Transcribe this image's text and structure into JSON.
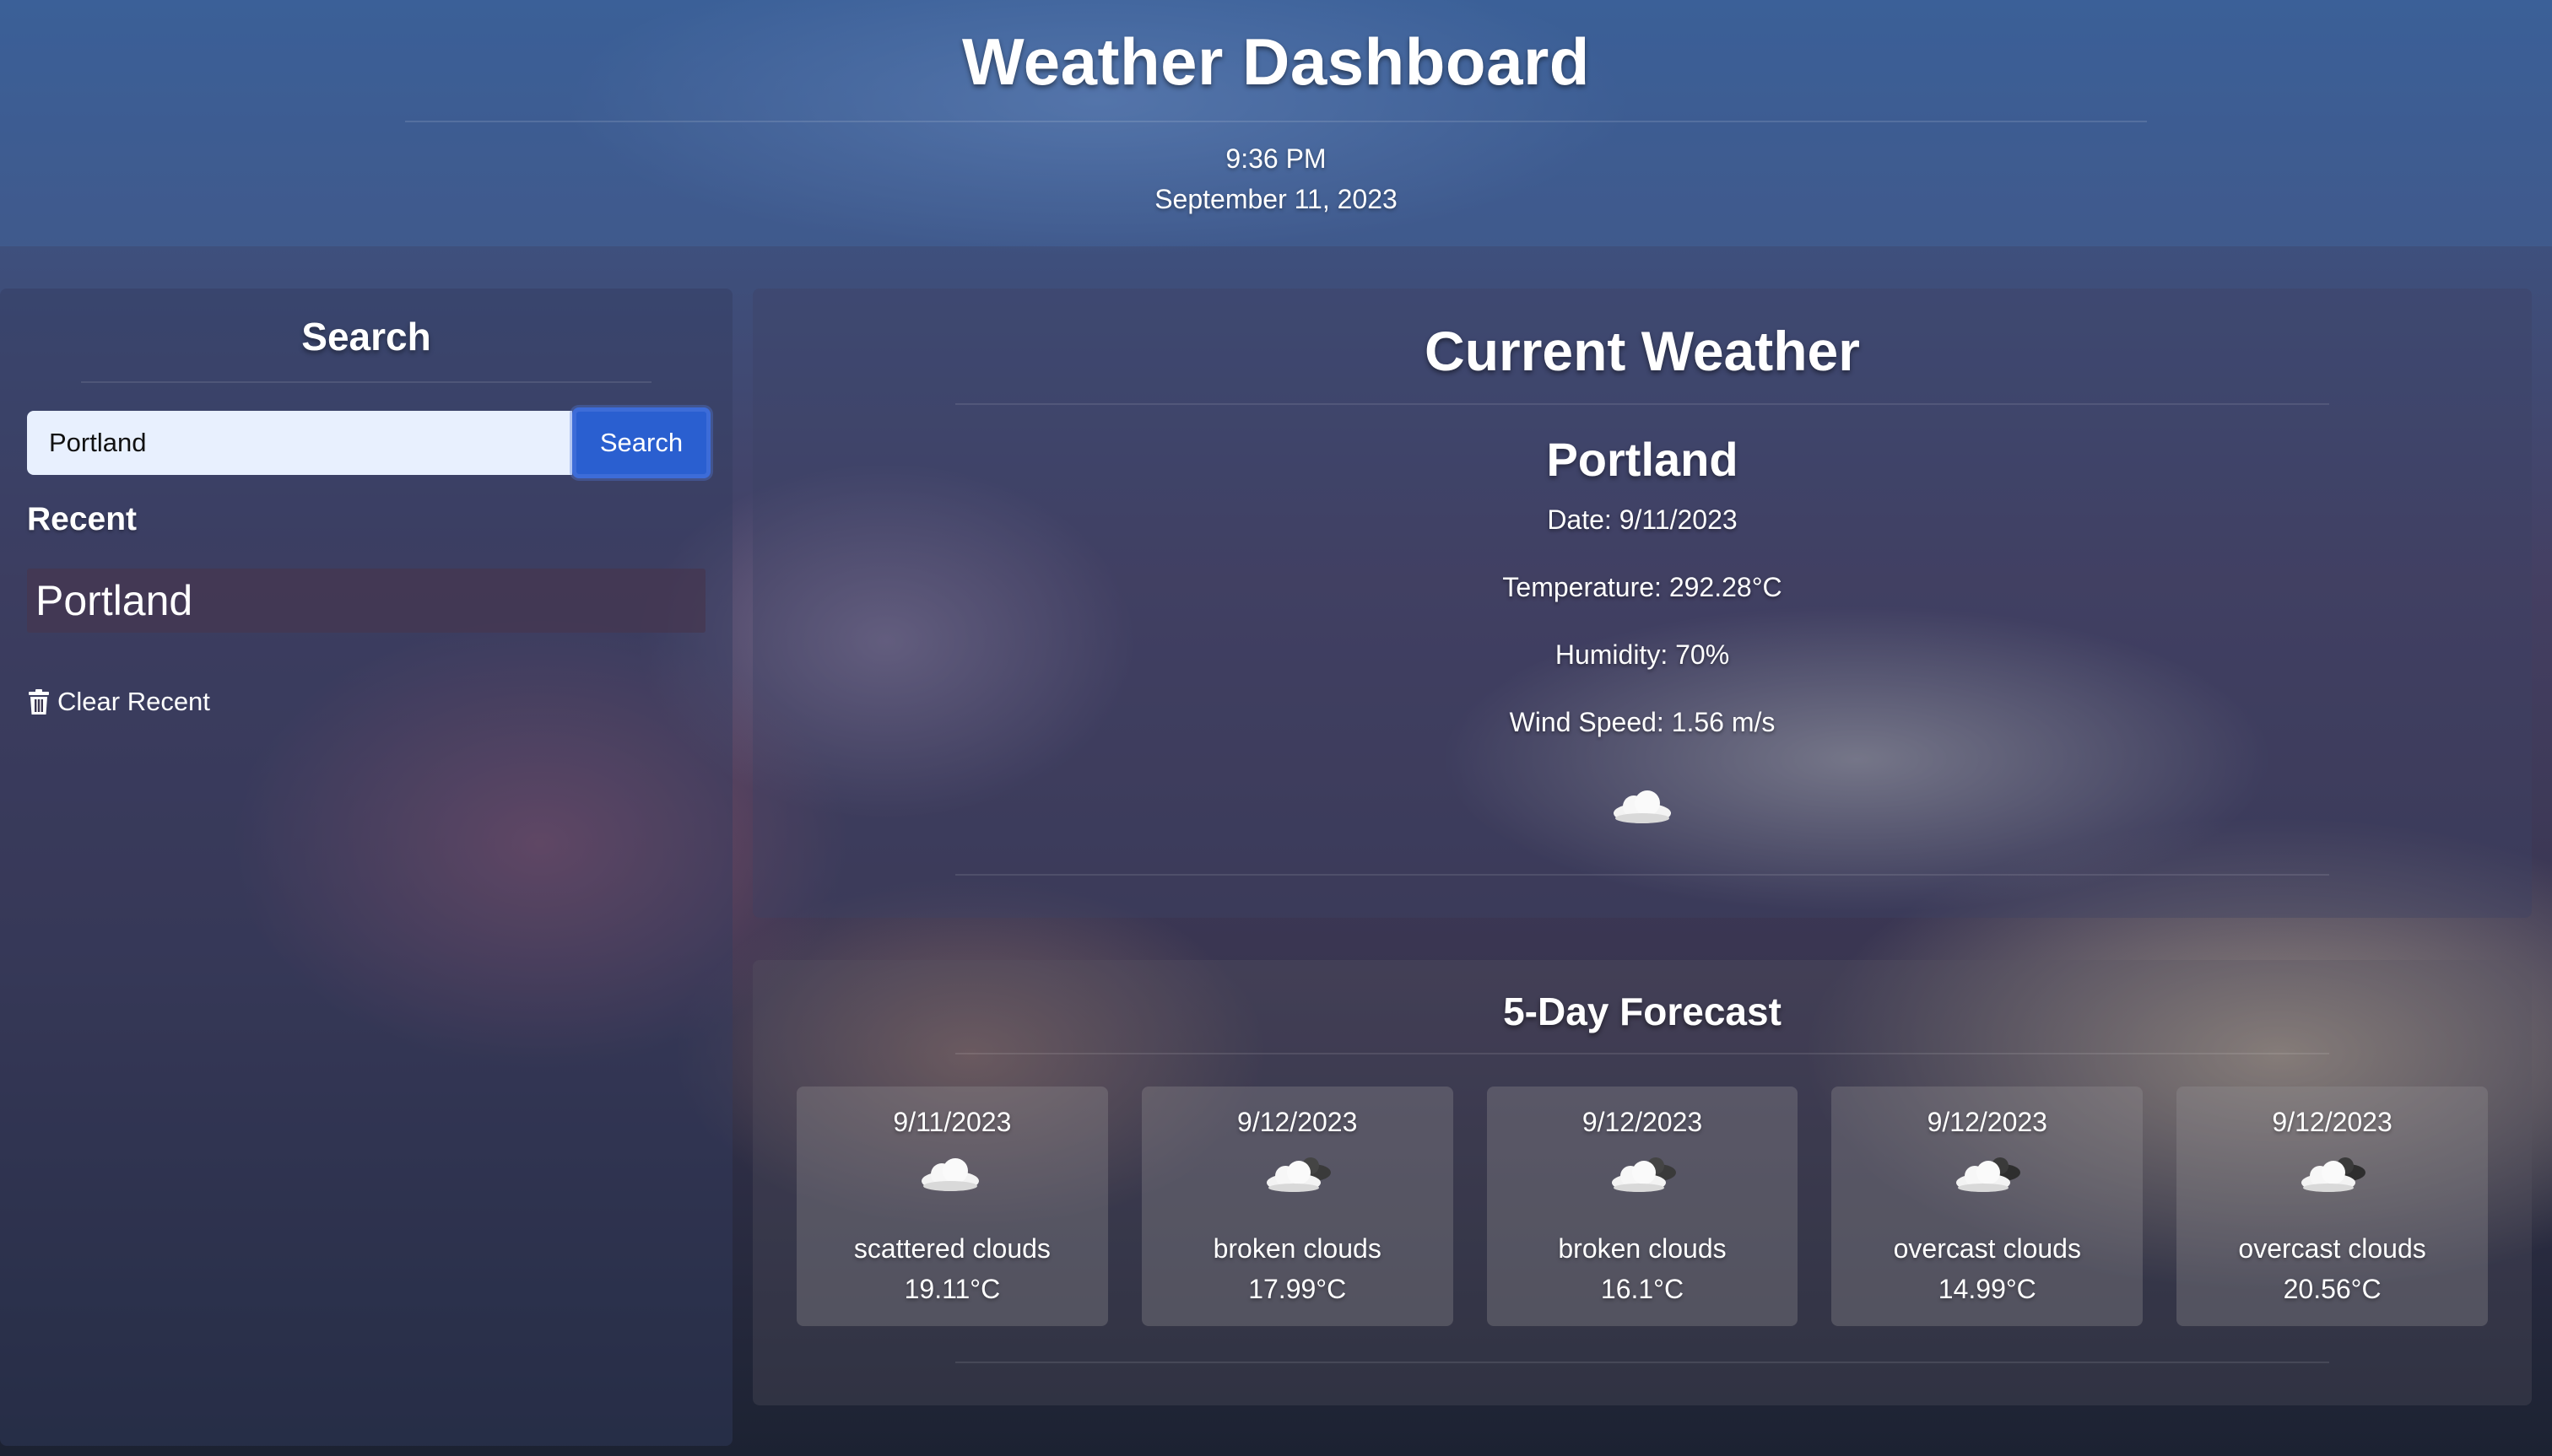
{
  "header": {
    "title": "Weather Dashboard",
    "time": "9:36 PM",
    "date": "September 11, 2023"
  },
  "sidebar": {
    "heading": "Search",
    "search": {
      "value": "Portland",
      "button_label": "Search"
    },
    "recent_label": "Recent",
    "recent_items": [
      "Portland"
    ],
    "clear_label": "Clear Recent",
    "clear_icon": "trash-icon"
  },
  "current": {
    "heading": "Current Weather",
    "city": "Portland",
    "date_line": "Date: 9/11/2023",
    "temperature_line": "Temperature: 292.28°C",
    "humidity_line": "Humidity: 70%",
    "wind_line": "Wind Speed: 1.56 m/s",
    "icon": "cloud-icon"
  },
  "forecast": {
    "heading": "5-Day Forecast",
    "days": [
      {
        "date": "9/11/2023",
        "icon": "cloud-icon",
        "description": "scattered clouds",
        "temp": "19.11°C"
      },
      {
        "date": "9/12/2023",
        "icon": "broken-clouds-icon",
        "description": "broken clouds",
        "temp": "17.99°C"
      },
      {
        "date": "9/12/2023",
        "icon": "broken-clouds-icon",
        "description": "broken clouds",
        "temp": "16.1°C"
      },
      {
        "date": "9/12/2023",
        "icon": "overcast-clouds-icon",
        "description": "overcast clouds",
        "temp": "14.99°C"
      },
      {
        "date": "9/12/2023",
        "icon": "overcast-clouds-icon",
        "description": "overcast clouds",
        "temp": "20.56°C"
      }
    ]
  },
  "colors": {
    "search_button": "#2a5fd0",
    "search_input_bg": "#e8f0fe",
    "recent_item_bg": "#46374f"
  }
}
